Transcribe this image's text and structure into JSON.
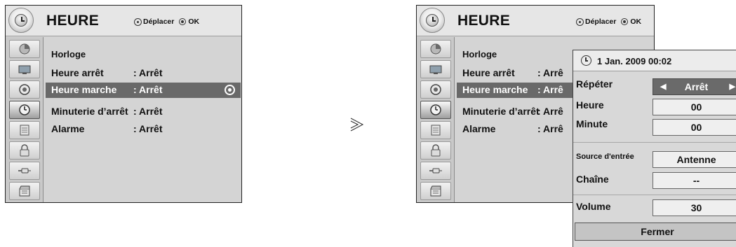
{
  "menu": {
    "title": "HEURE",
    "hint_move": "Déplacer",
    "hint_ok": "OK",
    "items": [
      {
        "label": "Horloge",
        "value": ""
      },
      {
        "label": "Heure arrêt",
        "value": ": Arrêt"
      },
      {
        "label": "Heure marche",
        "value": ": Arrêt"
      },
      {
        "label": "Minuterie d’arrêt",
        "value": ": Arrêt"
      },
      {
        "label": "Alarme",
        "value": ": Arrêt"
      }
    ],
    "selected_item": "Heure marche"
  },
  "menu_right": {
    "title": "HEURE",
    "hint_move": "Déplacer",
    "hint_ok": "OK",
    "items": [
      {
        "label": "Horloge",
        "value": ""
      },
      {
        "label": "Heure arrêt",
        "value": ": Arrê"
      },
      {
        "label": "Heure marche",
        "value": ": Arrê"
      },
      {
        "label": "Minuterie d’arrêt",
        "value": ": Arrê"
      },
      {
        "label": "Alarme",
        "value": ": Arrê"
      }
    ]
  },
  "sidebar_icons": [
    "picture-icon",
    "screen-icon",
    "audio-icon",
    "time-icon",
    "option-icon",
    "lock-icon",
    "input-icon",
    "media-icon"
  ],
  "transition_arrow": "≫",
  "popup": {
    "datetime": "1 Jan. 2009 00:02",
    "fields": [
      {
        "label": "Répéter",
        "value": "Arrêt"
      },
      {
        "label": "Heure",
        "value": "00"
      },
      {
        "label": "Minute",
        "value": "00"
      },
      {
        "label": "Source d'entrée",
        "value": "Antenne"
      },
      {
        "label": "Chaîne",
        "value": "--"
      },
      {
        "label": "Volume",
        "value": "30"
      }
    ],
    "close_label": "Fermer"
  },
  "colors": {
    "panel_bg": "#d4d4d4",
    "header_bg": "#e6e6e6",
    "highlight": "#696969",
    "selected_value": "#6a6a6a"
  }
}
